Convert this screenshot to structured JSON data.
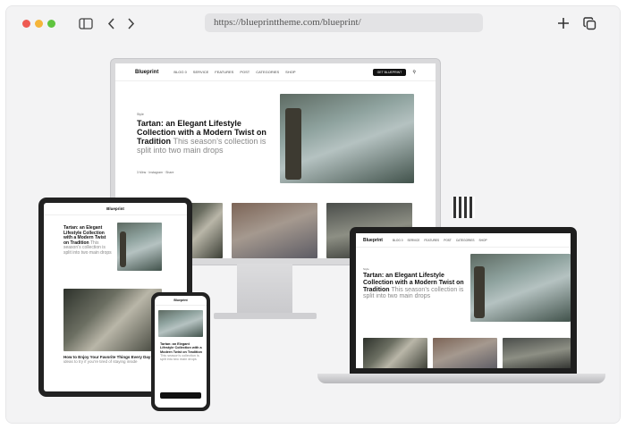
{
  "browser": {
    "url": "https://blueprinttheme.com/blueprint/"
  },
  "site": {
    "logo": "Blueprint",
    "nav": {
      "blog_label": "BLOG 0",
      "items": [
        "SERVICE",
        "FEATURES",
        "POST",
        "CATEGORIES",
        "SHOP"
      ],
      "cta": "GET BLUEPRINT"
    },
    "hero": {
      "tag": "Style",
      "headline": "Tartan: an Elegant Lifestyle Collection with a Modern Twist on Tradition",
      "subline": "This season’s collection is split into two main drops",
      "meta": "3 Mins · Instagram · Share"
    },
    "second_post": {
      "headline": "How to Enjoy Your Favorite Things Every Day",
      "subline": "date ideas to try if you’re tired of staying inside"
    }
  },
  "icons": [
    "sidebar-toggle-icon",
    "back-icon",
    "forward-icon",
    "new-tab-icon",
    "copy-tabs-icon",
    "qr-code-icon"
  ],
  "colors": {
    "close": "#ee5a52",
    "minimize": "#f5b53a",
    "maximize": "#5fc43f"
  }
}
